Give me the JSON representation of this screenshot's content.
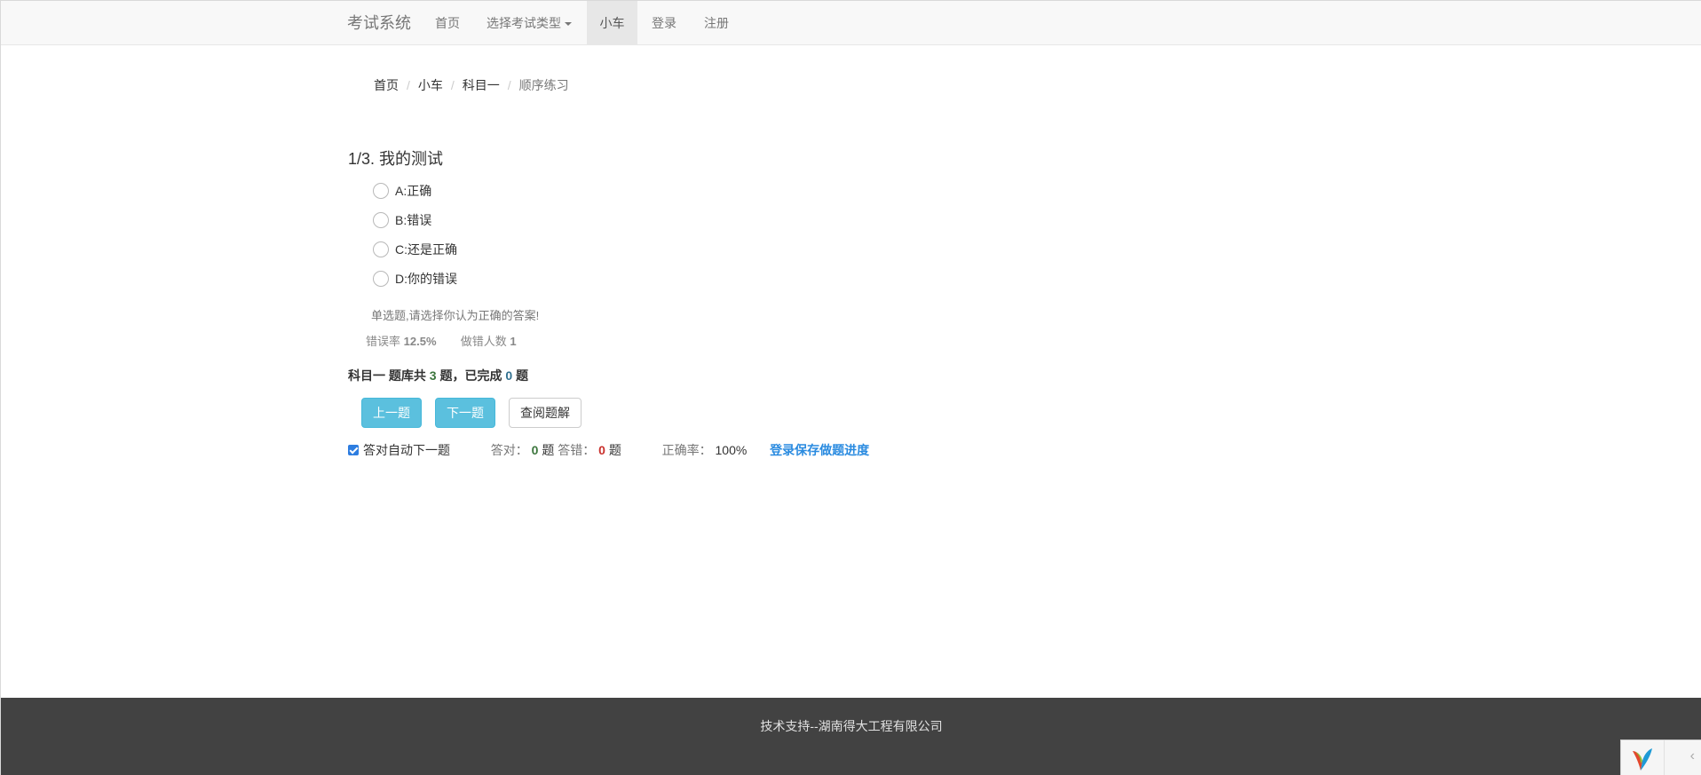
{
  "navbar": {
    "brand": "考试系统",
    "items": [
      {
        "label": "首页"
      },
      {
        "label": "选择考试类型"
      },
      {
        "label": "小车"
      },
      {
        "label": "登录"
      },
      {
        "label": "注册"
      }
    ]
  },
  "breadcrumb": [
    "首页",
    "小车",
    "科目一",
    "顺序练习"
  ],
  "question": {
    "title": "1/3. 我的测试",
    "options": [
      "A:正确",
      "B:错误",
      "C:还是正确",
      "D:你的错误"
    ],
    "hint": "单选题,请选择你认为正确的答案!",
    "error_rate_label": "错误率",
    "error_rate_value": "12.5%",
    "wrong_count_label": "做错人数",
    "wrong_count_value": "1"
  },
  "summary": {
    "prefix": "科目一 题库共",
    "total": "3",
    "middle": "题，已完成",
    "done": "0",
    "suffix": "题"
  },
  "buttons": {
    "prev": "上一题",
    "next": "下一题",
    "analysis": "查阅题解"
  },
  "progress": {
    "auto_next_label": "答对自动下一题",
    "auto_next_checked": true,
    "correct_label": "答对：",
    "correct_value": "0",
    "wrong_label": "答错：",
    "wrong_value": "0",
    "unit": "题",
    "accuracy_label": "正确率：",
    "accuracy_value": "100%",
    "save_link": "登录保存做题进度"
  },
  "footer": {
    "text": "技术支持--湖南得大工程有限公司"
  },
  "debug_toolbar": {
    "toggle_icon": "‹"
  },
  "colors": {
    "accent": "#5bc0de",
    "link": "#2a8be0",
    "footer_bg": "#424242",
    "correct": "#3c763d",
    "wrong": "#c9302c"
  }
}
